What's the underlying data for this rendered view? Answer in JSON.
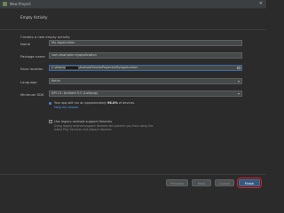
{
  "window": {
    "title": "New Project"
  },
  "header": {
    "title": "Empty Activity"
  },
  "subtitle": "Creates a new empty activity",
  "form": {
    "name": {
      "label": "Name",
      "value": "My Application"
    },
    "package": {
      "label": "Package name",
      "value": "com.example.myapplication"
    },
    "save": {
      "label": "Save location",
      "prefix": "C:\\Users\\",
      "suffix": "\\AndroidStudioProjects\\MyApplication"
    },
    "language": {
      "label": "Language",
      "value": "Kotlin"
    },
    "minsdk": {
      "label": "Minimum SDK",
      "value": "API 21: Android 5.0 (Lollipop)"
    }
  },
  "info": {
    "text_prefix": "Your app will run on approximately ",
    "percent": "98.0%",
    "text_suffix": " of devices.",
    "link": "Help me choose"
  },
  "legacy": {
    "label": "Use legacy android.support libraries",
    "description": "Using legacy android.support libraries will prevent you from using the latest Play Services and Jetpack libraries"
  },
  "footer": {
    "previous": "Previous",
    "next": "Next",
    "cancel": "Cancel",
    "finish": "Finish"
  }
}
